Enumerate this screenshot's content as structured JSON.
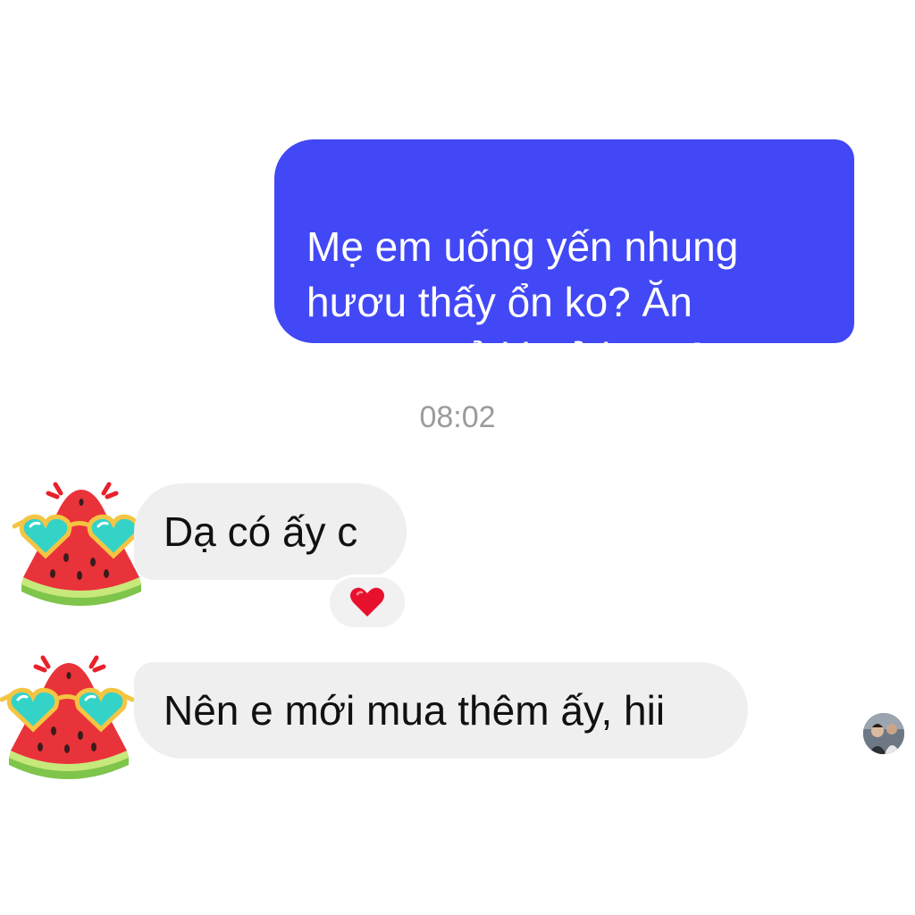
{
  "conversation": {
    "outgoing_message": "Mẹ em uống yến nhung\nhươu thấy ổn ko? Ăn\nngon, ngủ khoẻ hơm?",
    "timestamp": "08:02",
    "incoming_messages": [
      {
        "text": "Dạ có ấy c",
        "sticker_icon": "watermelon-sunglasses-icon"
      },
      {
        "text": "Nên e mới mua thêm ấy, hii",
        "sticker_icon": "watermelon-sunglasses-icon"
      }
    ],
    "reaction": {
      "icon": "heart-icon",
      "color": "#e8112d"
    },
    "seen_avatar_icon": "seen-avatar"
  },
  "colors": {
    "outgoing_bubble": "#4248f5",
    "incoming_bubble": "#efefef",
    "timestamp_text": "#9b9b9b",
    "background": "#ffffff"
  }
}
